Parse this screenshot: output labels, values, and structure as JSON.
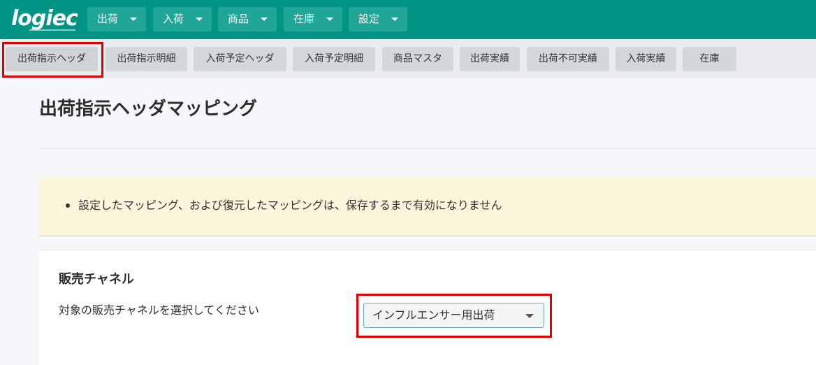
{
  "app": {
    "logo_text": "logiec"
  },
  "nav": [
    {
      "label": "出荷"
    },
    {
      "label": "入荷"
    },
    {
      "label": "商品"
    },
    {
      "label": "在庫"
    },
    {
      "label": "設定"
    }
  ],
  "tabs": [
    {
      "label": "出荷指示ヘッダ",
      "active": true
    },
    {
      "label": "出荷指示明細"
    },
    {
      "label": "入荷予定ヘッダ"
    },
    {
      "label": "入荷予定明細"
    },
    {
      "label": "商品マスタ"
    },
    {
      "label": "出荷実績"
    },
    {
      "label": "出荷不可実績"
    },
    {
      "label": "入荷実績"
    },
    {
      "label": "在庫"
    }
  ],
  "page": {
    "title": "出荷指示ヘッダマッピング"
  },
  "notice": {
    "text": "設定したマッピング、および復元したマッピングは、保存するまで有効になりません"
  },
  "channel": {
    "title": "販売チャネル",
    "label": "対象の販売チャネルを選択してください",
    "selected": "インフルエンサー用出荷"
  },
  "colors": {
    "topbar": "#009485",
    "nav_button": "#1fa697",
    "highlight": "#e00000",
    "notice_bg": "#fdf6dd"
  }
}
